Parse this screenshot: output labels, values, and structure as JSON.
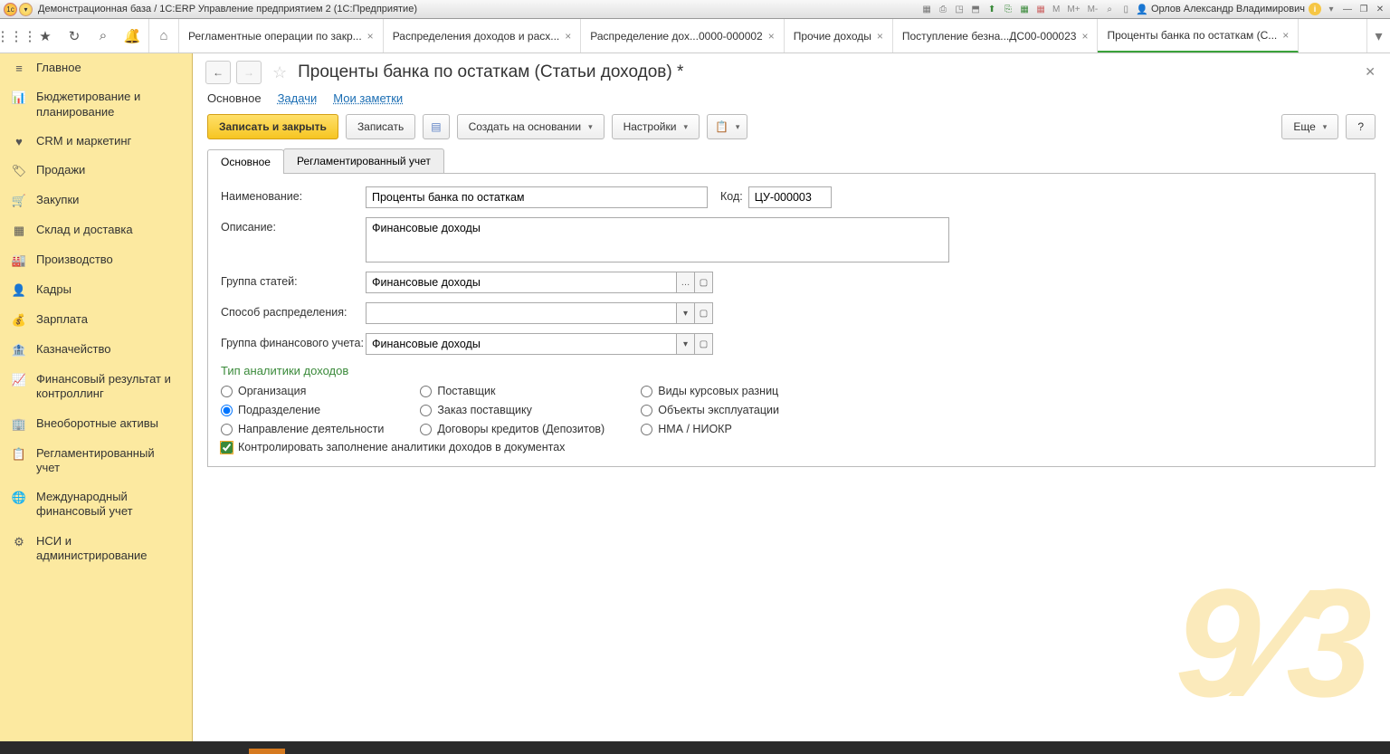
{
  "titlebar": {
    "text": "Демонстрационная база / 1С:ERP Управление предприятием 2  (1С:Предприятие)",
    "menu_m": "M",
    "menu_mp": "M+",
    "menu_mm": "M-",
    "user": "Орлов Александр Владимирович"
  },
  "tabs": [
    {
      "label": "Регламентные операции по закр..."
    },
    {
      "label": "Распределения доходов и расх..."
    },
    {
      "label": "Распределение дох...0000-000002"
    },
    {
      "label": "Прочие доходы"
    },
    {
      "label": "Поступление безна...ДС00-000023"
    },
    {
      "label": "Проценты банка по остаткам (С...",
      "active": true
    }
  ],
  "sidebar": [
    {
      "icon": "≡",
      "label": "Главное"
    },
    {
      "icon": "📊",
      "label": "Бюджетирование и планирование"
    },
    {
      "icon": "♥",
      "label": "CRM и маркетинг"
    },
    {
      "icon": "🏷",
      "label": "Продажи"
    },
    {
      "icon": "🛒",
      "label": "Закупки"
    },
    {
      "icon": "▦",
      "label": "Склад и доставка"
    },
    {
      "icon": "🏭",
      "label": "Производство"
    },
    {
      "icon": "👤",
      "label": "Кадры"
    },
    {
      "icon": "💰",
      "label": "Зарплата"
    },
    {
      "icon": "🏦",
      "label": "Казначейство"
    },
    {
      "icon": "📈",
      "label": "Финансовый результат и контроллинг"
    },
    {
      "icon": "🏢",
      "label": "Внеоборотные активы"
    },
    {
      "icon": "📋",
      "label": "Регламентированный учет"
    },
    {
      "icon": "🌐",
      "label": "Международный финансовый учет"
    },
    {
      "icon": "⚙",
      "label": "НСИ и администрирование"
    }
  ],
  "page": {
    "back": "←",
    "forward": "→",
    "star": "☆",
    "title": "Проценты банка по остаткам (Статьи доходов) *",
    "sublinks": {
      "main": "Основное",
      "tasks": "Задачи",
      "notes": "Мои заметки"
    },
    "actions": {
      "save_close": "Записать и закрыть",
      "save": "Записать",
      "create": "Создать на основании",
      "settings": "Настройки",
      "more": "Еще",
      "help": "?"
    },
    "inner_tabs": {
      "main": "Основное",
      "regl": "Регламентированный учет"
    },
    "form": {
      "name_lbl": "Наименование:",
      "name_val": "Проценты банка по остаткам",
      "code_lbl": "Код:",
      "code_val": "ЦУ-000003",
      "desc_lbl": "Описание:",
      "desc_val": "Финансовые доходы",
      "group_lbl": "Группа статей:",
      "group_val": "Финансовые доходы",
      "distr_lbl": "Способ распределения:",
      "distr_val": "",
      "fin_lbl": "Группа финансового учета:",
      "fin_val": "Финансовые доходы",
      "section": "Тип аналитики доходов",
      "radios": {
        "c1": [
          "Организация",
          "Подразделение",
          "Направление деятельности"
        ],
        "c2": [
          "Поставщик",
          "Заказ поставщику",
          "Договоры кредитов (Депозитов)"
        ],
        "c3": [
          "Виды курсовых разниц",
          "Объекты эксплуатации",
          "НМА / НИОКР"
        ]
      },
      "checkbox": "Контролировать заполнение аналитики доходов в документах"
    }
  }
}
